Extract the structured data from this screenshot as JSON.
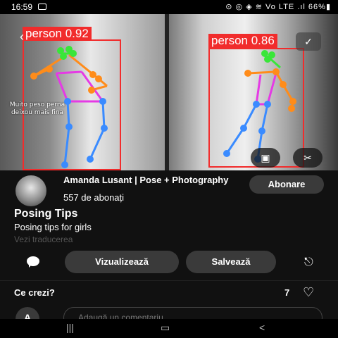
{
  "status": {
    "time": "16:59",
    "right_text": "⊙ ◎ ◈ ≋ Vo LTE .ıl 66%▮"
  },
  "hero": {
    "detections": [
      {
        "label": "person 0.92"
      },
      {
        "label": "person 0.86"
      }
    ],
    "caption": "Muito peso perna deixou mais fina"
  },
  "author": {
    "name": "Amanda Lusant | Pose + Photography",
    "followers": "557 de abonați",
    "subscribe_label": "Abonare"
  },
  "pin": {
    "title": "Posing Tips",
    "description": "Posing tips for girls",
    "translate_label": "Vezi traducerea"
  },
  "actions": {
    "view_label": "Vizualizează",
    "save_label": "Salvează"
  },
  "comments": {
    "prompt": "Ce crezi?",
    "likes": "7",
    "avatar_letter": "A",
    "input_placeholder": "Adaugă un comentariu"
  },
  "icons": {
    "back": "chevron-left-icon",
    "check": "check-icon",
    "scan": "scan-icon",
    "scissors": "scissors-icon",
    "comment": "comment-icon",
    "share": "share-icon",
    "heart": "heart-icon"
  },
  "colors": {
    "detection": "#f12c2c",
    "background": "#111111",
    "button": "#3a3a3a"
  }
}
